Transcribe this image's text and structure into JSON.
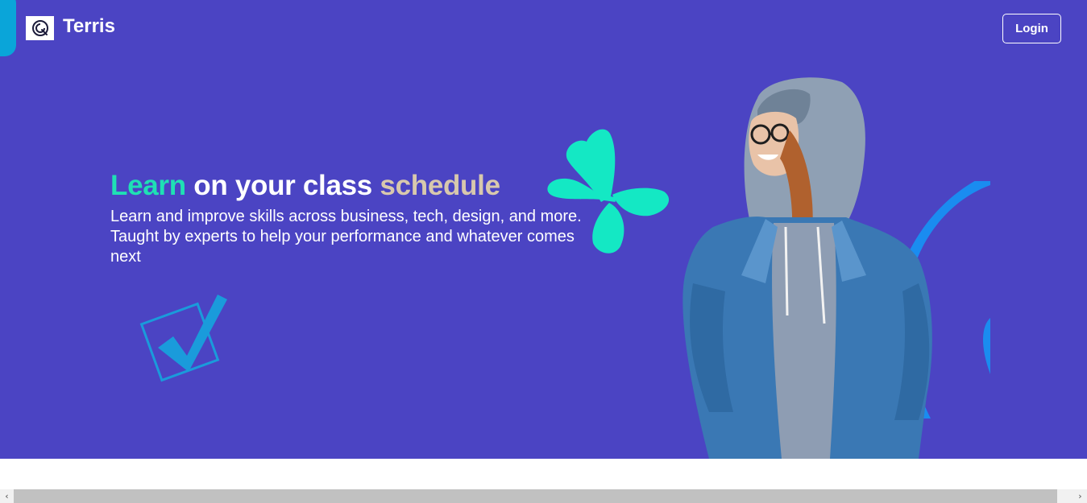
{
  "header": {
    "brand_name": "Terris",
    "logo_icon": "spiral-logo-icon",
    "login_label": "Login"
  },
  "hero": {
    "headline_word1": "Learn",
    "headline_middle": " on your class ",
    "headline_word2": "schedule",
    "subtext": "Learn and improve skills across business, tech, design, and more. Taught by experts to help your performance and whatever comes next",
    "colors": {
      "background": "#4b44c3",
      "accent_teal": "#1fe0b4",
      "accent_beige": "#d8c8ad",
      "butterfly": "#14e8c4",
      "arc": "#1a8cf0",
      "check": "#1a9bdb"
    },
    "decor_icons": [
      "checkbox-check-icon",
      "butterfly-icon",
      "arc-shape"
    ]
  },
  "scrollbar": {
    "left_arrow": "‹",
    "right_arrow": "›"
  }
}
